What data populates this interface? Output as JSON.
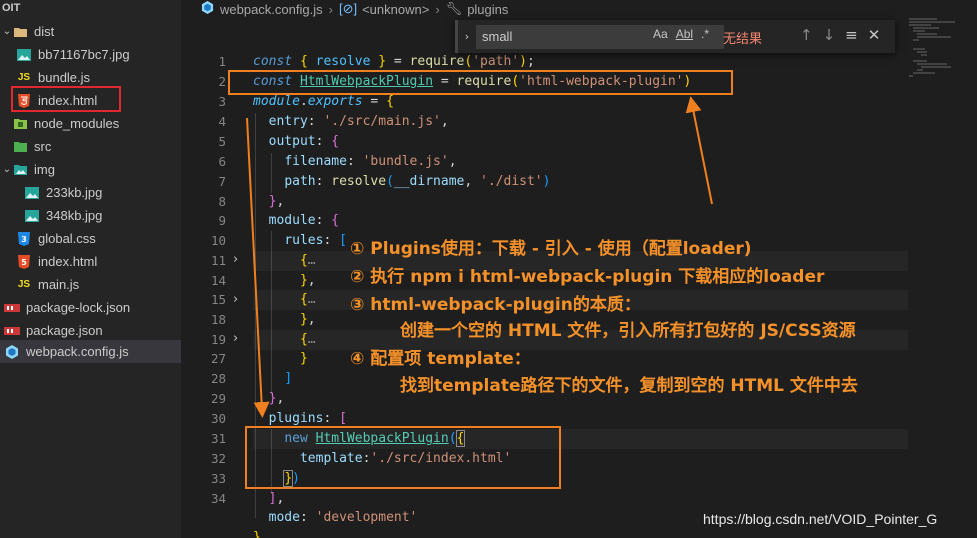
{
  "sidebar": {
    "header": "OIT",
    "items": [
      {
        "label": "dist",
        "icon": "folder-open-icon",
        "chevron": "∨"
      },
      {
        "label": "bb71167bc7.jpg",
        "icon": "image-file-icon"
      },
      {
        "label": "bundle.js",
        "icon": "js-file-icon",
        "icon_text": "JS"
      },
      {
        "label": "index.html",
        "icon": "html-file-icon"
      },
      {
        "label": "node_modules",
        "icon": "folder-icon",
        "chevron": "›"
      },
      {
        "label": "src",
        "icon": "folder-icon",
        "chevron": "∨"
      },
      {
        "label": "img",
        "icon": "folder-open-icon",
        "chevron": "∨"
      },
      {
        "label": "233kb.jpg",
        "icon": "image-file-icon"
      },
      {
        "label": "348kb.jpg",
        "icon": "image-file-icon"
      },
      {
        "label": "global.css",
        "icon": "css-file-icon"
      },
      {
        "label": "index.html",
        "icon": "html-file-icon"
      },
      {
        "label": "main.js",
        "icon": "js-file-icon",
        "icon_text": "JS"
      },
      {
        "label": "package-lock.json",
        "icon": "json-file-icon"
      },
      {
        "label": "package.json",
        "icon": "json-file-icon"
      },
      {
        "label": "webpack.config.js",
        "icon": "webpack-icon"
      }
    ]
  },
  "breadcrumb": {
    "file": "webpack.config.js",
    "symbol1": "<unknown>",
    "symbol2": "plugins"
  },
  "find": {
    "value": "small",
    "opt_case": "Aa",
    "opt_word": "Abl",
    "opt_regex": ".*",
    "result": "无结果",
    "prev": "↑",
    "next": "↓",
    "menu": "≡",
    "close": "✕"
  },
  "editor": {
    "line_numbers": [
      "1",
      "2",
      "3",
      "4",
      "5",
      "6",
      "7",
      "8",
      "9",
      "10",
      "11",
      "14",
      "15",
      "18",
      "19",
      "27",
      "28",
      "29",
      "30",
      "31",
      "32",
      "33",
      "34"
    ]
  },
  "annotations": {
    "line1": "① Plugins使用：下载 - 引入 - 使用（配置loader)",
    "line2": "② 执行 npm i html-webpack-plugin 下载相应的loader",
    "line3": "③ html-webpack-plugin的本质：",
    "line4": "创建一个空的 HTML 文件，引入所有打包好的 JS/CSS资源",
    "line5": "④ 配置项 template：",
    "line6": "找到template路径下的文件，复制到空的 HTML 文件中去"
  },
  "watermark": "https://blog.csdn.net/VOID_Pointer_G",
  "colors": {
    "annotation": "#f59129",
    "highlight_box": "#e3272e",
    "editor_bg": "#1e1e1e",
    "sidebar_bg": "#252526"
  }
}
